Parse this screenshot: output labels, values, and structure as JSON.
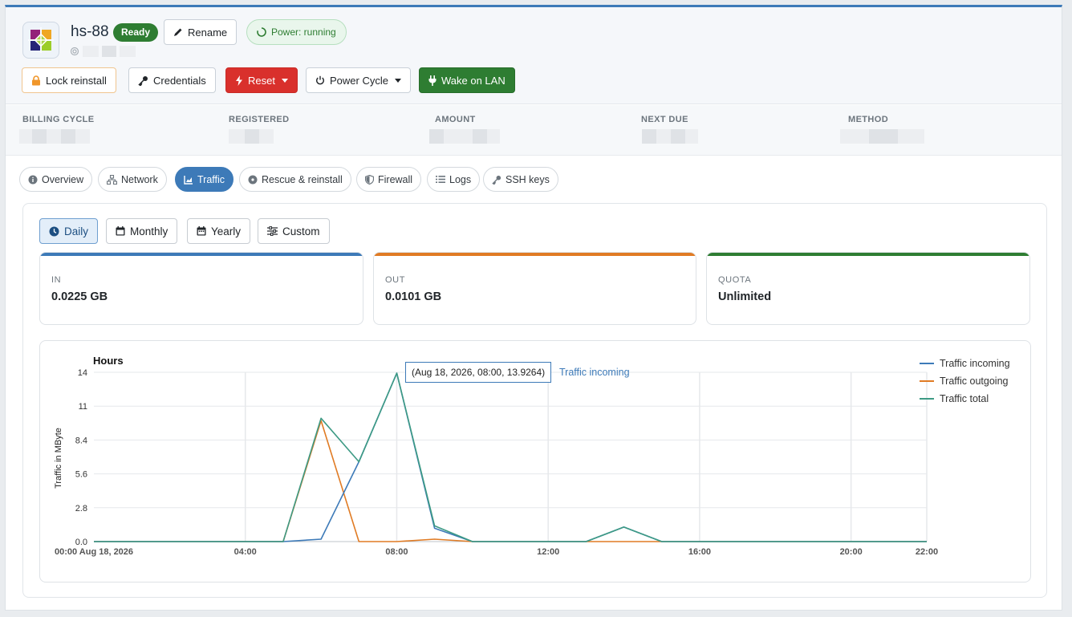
{
  "server": {
    "hostname": "hs-88",
    "status": "Ready",
    "power": "Power: running"
  },
  "header": {
    "rename": "Rename",
    "lock_reinstall": "Lock reinstall",
    "credentials": "Credentials",
    "reset": "Reset",
    "power_cycle": "Power Cycle",
    "wake_on_lan": "Wake on LAN"
  },
  "billing": {
    "billing_cycle": "BILLING CYCLE",
    "registered": "REGISTERED",
    "amount": "AMOUNT",
    "next_due": "NEXT DUE",
    "method": "METHOD"
  },
  "tabs": [
    {
      "label": "Overview",
      "icon": "info-circle-icon"
    },
    {
      "label": "Network",
      "icon": "network-icon"
    },
    {
      "label": "Traffic",
      "icon": "chart-area-icon",
      "active": true
    },
    {
      "label": "Rescue & reinstall",
      "icon": "disc-icon"
    },
    {
      "label": "Firewall",
      "icon": "shield-icon"
    },
    {
      "label": "Logs",
      "icon": "list-icon"
    },
    {
      "label": "SSH keys",
      "icon": "key-icon"
    }
  ],
  "periods": [
    {
      "label": "Daily",
      "icon": "clock-icon",
      "active": true
    },
    {
      "label": "Monthly",
      "icon": "calendar-icon"
    },
    {
      "label": "Yearly",
      "icon": "calendar-icon"
    },
    {
      "label": "Custom",
      "icon": "sliders-icon"
    }
  ],
  "stats": {
    "in": {
      "label": "IN",
      "value": "0.0225 GB",
      "color": "#3d7ab8"
    },
    "out": {
      "label": "OUT",
      "value": "0.0101 GB",
      "color": "#e07b24"
    },
    "quota": {
      "label": "QUOTA",
      "value": "Unlimited",
      "color": "#2e7d32"
    }
  },
  "tooltip": {
    "text": "(Aug 18, 2026, 08:00, 13.9264)",
    "series": "Traffic incoming"
  },
  "chart_data": {
    "type": "line",
    "title": "Hours",
    "ylabel": "Traffic in MByte",
    "ylim": [
      0,
      14
    ],
    "yticks": [
      "0.0",
      "2.8",
      "5.6",
      "8.4",
      "11",
      "14"
    ],
    "xtick_labels": [
      {
        "hour": 0,
        "label": "00:00 Aug 18, 2026"
      },
      {
        "hour": 4,
        "label": "04:00"
      },
      {
        "hour": 8,
        "label": "08:00"
      },
      {
        "hour": 12,
        "label": "12:00"
      },
      {
        "hour": 16,
        "label": "16:00"
      },
      {
        "hour": 20,
        "label": "20:00"
      },
      {
        "hour": 22,
        "label": "22:00"
      }
    ],
    "x": [
      0,
      1,
      2,
      3,
      4,
      5,
      6,
      7,
      8,
      9,
      10,
      11,
      12,
      13,
      14,
      15,
      16,
      17,
      18,
      19,
      20,
      21,
      22
    ],
    "legend_position": "top-right",
    "series": [
      {
        "name": "Traffic incoming",
        "color": "#3d7ab8",
        "values": [
          0,
          0,
          0,
          0,
          0,
          0,
          0.2,
          6.6,
          13.9264,
          1.1,
          0,
          0,
          0,
          0,
          1.2,
          0,
          0,
          0,
          0,
          0,
          0,
          0,
          0
        ]
      },
      {
        "name": "Traffic outgoing",
        "color": "#e07b24",
        "values": [
          0,
          0,
          0,
          0,
          0,
          0,
          10.0,
          0,
          0,
          0.2,
          0,
          0,
          0,
          0,
          0,
          0,
          0,
          0,
          0,
          0,
          0,
          0,
          0
        ]
      },
      {
        "name": "Traffic total",
        "color": "#3d9a84",
        "values": [
          0,
          0,
          0,
          0,
          0,
          0,
          10.2,
          6.6,
          13.9264,
          1.3,
          0,
          0,
          0,
          0,
          1.2,
          0,
          0,
          0,
          0,
          0,
          0,
          0,
          0
        ]
      }
    ]
  }
}
